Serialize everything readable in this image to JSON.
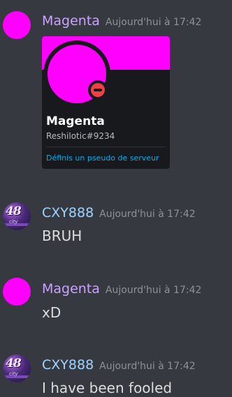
{
  "messages": [
    {
      "author": "Magenta",
      "timestamp": "Aujourd'hui à 17:42",
      "profile_card": {
        "display_name": "Magenta",
        "tag": "Reshilotic#9234",
        "action_link": "Définis un pseudo de serveur",
        "status": "dnd",
        "banner_color": "#ff00ff"
      }
    },
    {
      "author": "CXY888",
      "timestamp": "Aujourd'hui à 17:42",
      "text": "BRUH"
    },
    {
      "author": "Magenta",
      "timestamp": "Aujourd'hui à 17:42",
      "text": "xD"
    },
    {
      "author": "CXY888",
      "timestamp": "Aujourd'hui à 17:42",
      "text": "I have been fooled"
    }
  ],
  "cxy_avatar": {
    "big_text": "48",
    "small_text": "city"
  },
  "colors": {
    "background": "#36393f",
    "magenta_name": "#c9a4ff",
    "cxy_name": "#9fd4ff",
    "link": "#00aff4",
    "dnd": "#ed4245"
  }
}
